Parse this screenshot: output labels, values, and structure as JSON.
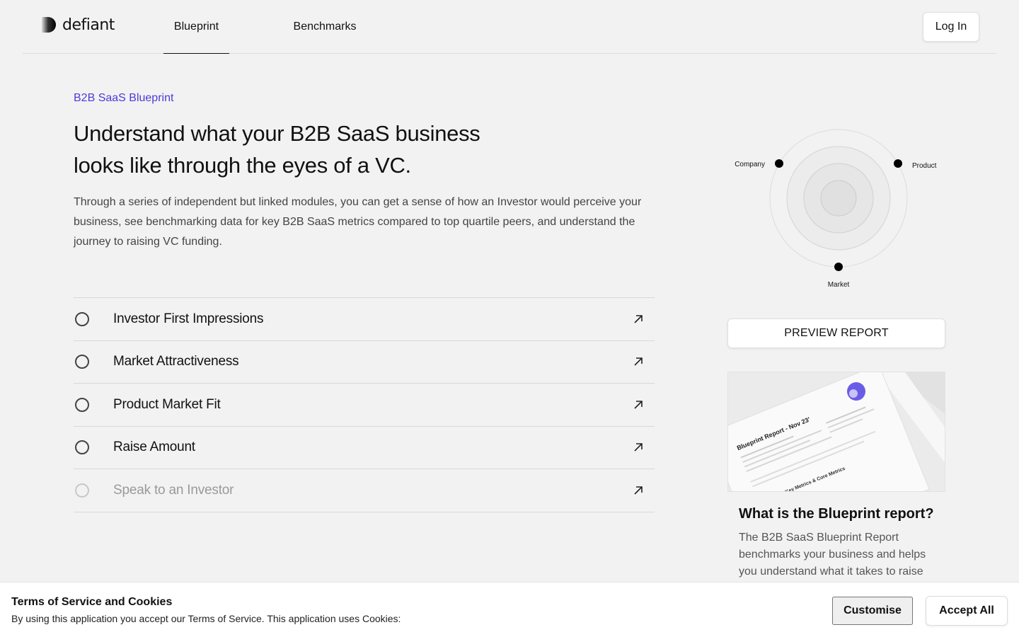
{
  "header": {
    "logo_text": "defiant",
    "logo_icon": "defiant-logo-mark",
    "tabs": [
      {
        "label": "Blueprint",
        "active": true
      },
      {
        "label": "Benchmarks",
        "active": false
      }
    ],
    "login_label": "Log In"
  },
  "hero": {
    "eyebrow": "B2B SaaS Blueprint",
    "title_line1": "Understand what your B2B SaaS business",
    "title_line2": "looks like through the eyes of a VC.",
    "intro": "Through a series of independent but linked modules, you can get a sense of how an Investor would perceive your business, see benchmarking data for key B2B SaaS metrics compared to top quartile peers, and understand the journey to raising VC funding."
  },
  "modules": [
    {
      "label": "Investor First Impressions",
      "status": "not-started",
      "icon": "arrow-up-right-icon"
    },
    {
      "label": "Market Attractiveness",
      "status": "not-started",
      "icon": "arrow-up-right-icon"
    },
    {
      "label": "Product Market Fit",
      "status": "not-started",
      "icon": "arrow-up-right-icon"
    },
    {
      "label": "Raise Amount",
      "status": "not-started",
      "icon": "arrow-up-right-icon"
    },
    {
      "label": "Speak to an Investor",
      "status": "locked",
      "icon": "arrow-up-right-icon"
    }
  ],
  "radar": {
    "labels": {
      "company": "Company",
      "product": "Product",
      "market": "Market"
    }
  },
  "preview_button": "PREVIEW REPORT",
  "report_card": {
    "image_heading": "Blueprint Report - Nov 23'",
    "image_subheading": "Key Metrics & Core Metrics",
    "title": "What is the Blueprint report?",
    "text": "The B2B SaaS Blueprint Report benchmarks your business and helps you understand what it takes to raise"
  },
  "cookie": {
    "title": "Terms of Service and Cookies",
    "text": "By using this application you accept our Terms of Service. This application uses Cookies:",
    "customise_label": "Customise",
    "accept_label": "Accept All"
  },
  "colors": {
    "accent": "#4b3ad9",
    "background": "#f2f2f2",
    "muted_text": "#9a9a9a"
  }
}
